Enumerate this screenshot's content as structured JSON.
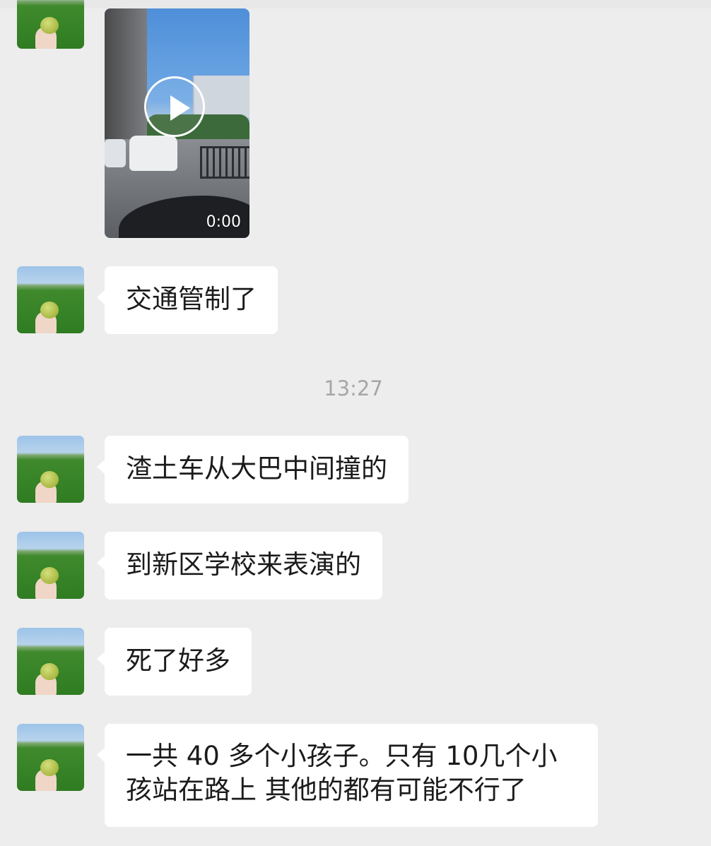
{
  "video_message": {
    "duration": "0:00"
  },
  "timestamp": "13:27",
  "messages": [
    {
      "text": "交通管制了"
    },
    {
      "text": "渣土车从大巴中间撞的"
    },
    {
      "text": "到新区学校来表演的"
    },
    {
      "text": "死了好多"
    },
    {
      "line1": "一共 40 多个小孩子。只有 10几个小",
      "line2": "孩站在路上 其他的都有可能不行了"
    }
  ]
}
